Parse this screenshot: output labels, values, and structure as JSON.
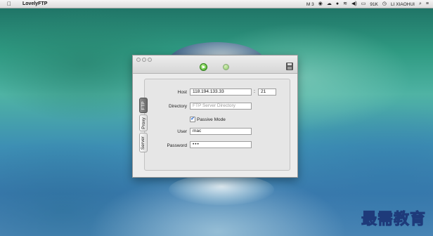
{
  "menubar": {
    "app_name": "LovelyFTP",
    "status_items": [
      "M 3",
      "91K",
      "LI XIAOHUI"
    ],
    "icons": [
      "apple-icon",
      "wifi-icon",
      "volume-icon",
      "battery-icon",
      "clock-icon",
      "search-icon",
      "list-icon"
    ]
  },
  "window": {
    "tabs": [
      "FTP",
      "Proxy",
      "Server"
    ],
    "form": {
      "host_label": "Host",
      "host_value": "118.194.133.33",
      "port_separator": ":",
      "port_value": "21",
      "directory_label": "Directory",
      "directory_placeholder": "FTP Server Directory",
      "passive_mode_label": "Passive Mode",
      "passive_mode_checked": true,
      "user_label": "User",
      "user_value": "mac",
      "password_label": "Password",
      "password_value": "•••"
    }
  },
  "watermark": "最需教育",
  "colors": {
    "accent_green": "#3aa51f",
    "selected_tab": "#6a6a6a"
  }
}
